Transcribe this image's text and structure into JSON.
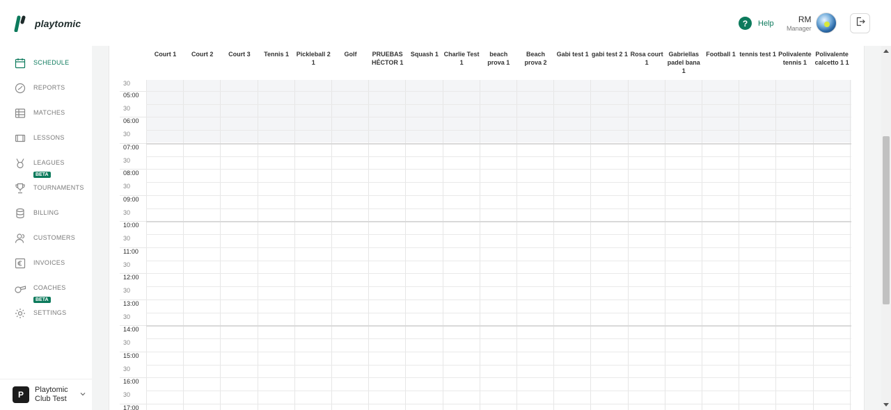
{
  "app": {
    "name": "playtomic",
    "accent_color": "#0c7a5c"
  },
  "header": {
    "help_label": "Help",
    "user_initials": "RM",
    "user_role": "Manager"
  },
  "sidebar": {
    "items": [
      {
        "label": "SCHEDULE",
        "icon": "calendar-icon",
        "active": true
      },
      {
        "label": "REPORTS",
        "icon": "reports-icon"
      },
      {
        "label": "MATCHES",
        "icon": "grid-icon"
      },
      {
        "label": "LESSONS",
        "icon": "ticket-icon"
      },
      {
        "label": "LEAGUES",
        "icon": "medal-icon",
        "badge": "BETA"
      },
      {
        "label": "TOURNAMENTS",
        "icon": "trophy-icon"
      },
      {
        "label": "BILLING",
        "icon": "coins-icon"
      },
      {
        "label": "CUSTOMERS",
        "icon": "users-icon"
      },
      {
        "label": "INVOICES",
        "icon": "euro-invoice-icon"
      },
      {
        "label": "COACHES",
        "icon": "whistle-icon",
        "badge": "BETA"
      },
      {
        "label": "SETTINGS",
        "icon": "gear-icon"
      }
    ]
  },
  "club": {
    "logo_letter": "P",
    "name": "Playtomic Club Test"
  },
  "courts": [
    "Court 1",
    "Court 2",
    "Court 3",
    "Tennis 1",
    "Pickleball 2 1",
    "Golf",
    "PRUEBAS HÉCTOR 1",
    "Squash 1",
    "Charlie Test 1",
    "beach prova 1",
    "Beach prova 2",
    "Gabi test 1",
    "gabi test 2 1",
    "Rosa court 1",
    "Gabriellas padel bana 1",
    "Football 1",
    "tennis test 1",
    "Polivalente tennis 1",
    "Polivalente calcetto 1 1"
  ],
  "times": [
    {
      "label": "30",
      "half": true
    },
    {
      "label": "05:00"
    },
    {
      "label": "30",
      "half": true
    },
    {
      "label": "06:00"
    },
    {
      "label": "30",
      "half": true
    },
    {
      "label": "07:00"
    },
    {
      "label": "30",
      "half": true
    },
    {
      "label": "08:00"
    },
    {
      "label": "30",
      "half": true
    },
    {
      "label": "09:00"
    },
    {
      "label": "30",
      "half": true
    },
    {
      "label": "10:00"
    },
    {
      "label": "30",
      "half": true
    },
    {
      "label": "11:00"
    },
    {
      "label": "30",
      "half": true
    },
    {
      "label": "12:00"
    },
    {
      "label": "30",
      "half": true
    },
    {
      "label": "13:00"
    },
    {
      "label": "30",
      "half": true
    },
    {
      "label": "14:00"
    },
    {
      "label": "30",
      "half": true
    },
    {
      "label": "15:00"
    },
    {
      "label": "30",
      "half": true
    },
    {
      "label": "16:00"
    },
    {
      "label": "30",
      "half": true
    },
    {
      "label": "17:00"
    }
  ]
}
